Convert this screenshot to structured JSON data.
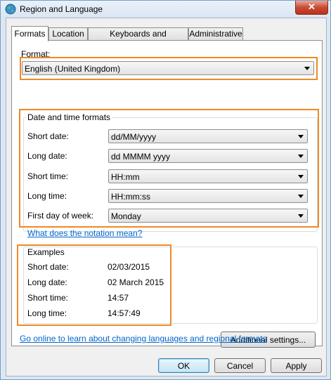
{
  "window": {
    "title": "Region and Language",
    "close_label": "✕"
  },
  "tabs": [
    {
      "label": "Formats",
      "active": true
    },
    {
      "label": "Location",
      "active": false
    },
    {
      "label": "Keyboards and Languages",
      "active": false
    },
    {
      "label": "Administrative",
      "active": false
    }
  ],
  "format": {
    "label": "Format:",
    "value": "English (United Kingdom)"
  },
  "date_time_formats": {
    "title": "Date and time formats",
    "short_date": {
      "label": "Short date:",
      "value": "dd/MM/yyyy"
    },
    "long_date": {
      "label": "Long date:",
      "value": "dd MMMM yyyy"
    },
    "short_time": {
      "label": "Short time:",
      "value": "HH:mm"
    },
    "long_time": {
      "label": "Long time:",
      "value": "HH:mm:ss"
    },
    "first_day": {
      "label": "First day of week:",
      "value": "Monday"
    }
  },
  "notation_link": "What does the notation mean?",
  "examples": {
    "title": "Examples",
    "short_date": {
      "label": "Short date:",
      "value": "02/03/2015"
    },
    "long_date": {
      "label": "Long date:",
      "value": "02 March 2015"
    },
    "short_time": {
      "label": "Short time:",
      "value": "14:57"
    },
    "long_time": {
      "label": "Long time:",
      "value": "14:57:49"
    }
  },
  "additional_settings_label": "Additional settings...",
  "online_link": "Go online to learn about changing languages and regional formats",
  "buttons": {
    "ok": "OK",
    "cancel": "Cancel",
    "apply": "Apply"
  },
  "colors": {
    "highlight": "#ee8a25",
    "link": "#0066cc"
  }
}
